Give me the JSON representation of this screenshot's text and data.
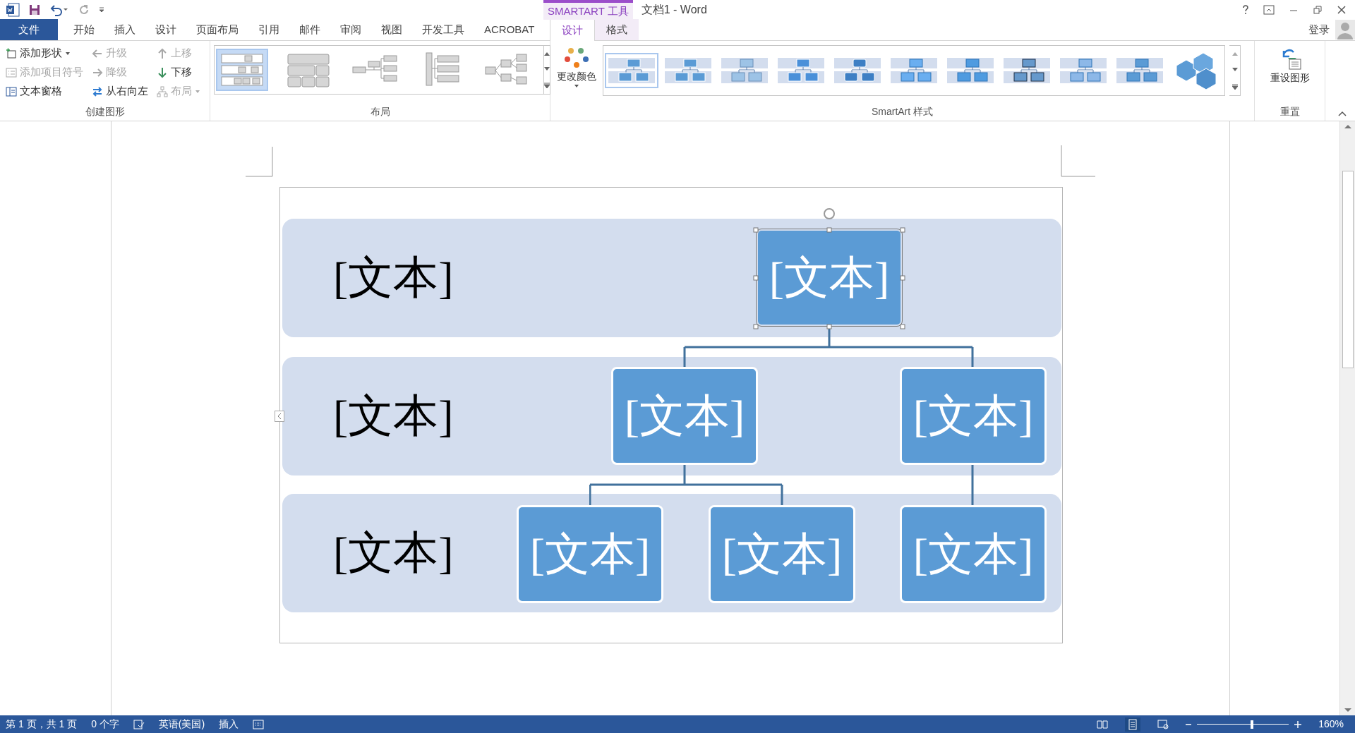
{
  "window": {
    "title": "文档1 - Word",
    "context_label": "SMARTART 工具",
    "sign_in": "登录"
  },
  "tabs": [
    {
      "label": "文件",
      "kind": "file",
      "selected": false
    },
    {
      "label": "开始",
      "kind": "tab",
      "selected": false
    },
    {
      "label": "插入",
      "kind": "tab",
      "selected": false
    },
    {
      "label": "设计",
      "kind": "tab",
      "selected": false
    },
    {
      "label": "页面布局",
      "kind": "tab",
      "selected": false
    },
    {
      "label": "引用",
      "kind": "tab",
      "selected": false
    },
    {
      "label": "邮件",
      "kind": "tab",
      "selected": false
    },
    {
      "label": "审阅",
      "kind": "tab",
      "selected": false
    },
    {
      "label": "视图",
      "kind": "tab",
      "selected": false
    },
    {
      "label": "开发工具",
      "kind": "tab",
      "selected": false
    },
    {
      "label": "ACROBAT",
      "kind": "tab",
      "selected": false
    },
    {
      "label": "设计",
      "kind": "context",
      "selected": true
    },
    {
      "label": "格式",
      "kind": "context",
      "selected": false
    }
  ],
  "create_group": {
    "label": "创建图形",
    "commands": [
      {
        "label": "添加形状",
        "disabled": false,
        "dropdown": true
      },
      {
        "label": "添加项目符号",
        "disabled": true,
        "dropdown": false
      },
      {
        "label": "文本窗格",
        "disabled": false,
        "dropdown": false
      },
      {
        "label": "升级",
        "disabled": true,
        "dropdown": false
      },
      {
        "label": "降级",
        "disabled": true,
        "dropdown": false
      },
      {
        "label": "从右向左",
        "disabled": false,
        "dropdown": false
      },
      {
        "label": "上移",
        "disabled": true,
        "dropdown": false
      },
      {
        "label": "下移",
        "disabled": false,
        "dropdown": false
      },
      {
        "label": "布局",
        "disabled": true,
        "dropdown": true
      }
    ]
  },
  "layout_group": {
    "label": "布局",
    "items": [
      {
        "selected": true
      },
      {
        "selected": false
      },
      {
        "selected": false
      },
      {
        "selected": false
      },
      {
        "selected": false
      }
    ]
  },
  "change_colors": {
    "label": "更改颜色"
  },
  "styles_group": {
    "label": "SmartArt 样式",
    "items": [
      {
        "selected": true
      },
      {
        "selected": false
      },
      {
        "selected": false
      },
      {
        "selected": false
      },
      {
        "selected": false
      },
      {
        "selected": false
      },
      {
        "selected": false
      },
      {
        "selected": false
      },
      {
        "selected": false
      },
      {
        "selected": false
      }
    ]
  },
  "reset_group": {
    "label": "重置",
    "button": "重设图形"
  },
  "diagram": {
    "rows": [
      {
        "label": "[文本]"
      },
      {
        "label": "[文本]"
      },
      {
        "label": "[文本]"
      }
    ],
    "nodes": [
      {
        "text": "[文本]",
        "selected": true
      },
      {
        "text": "[文本]",
        "selected": false
      },
      {
        "text": "[文本]",
        "selected": false
      },
      {
        "text": "[文本]",
        "selected": false
      },
      {
        "text": "[文本]",
        "selected": false
      },
      {
        "text": "[文本]",
        "selected": false
      }
    ]
  },
  "status_bar": {
    "page": "第 1 页，共 1 页",
    "words": "0 个字",
    "language": "英语(美国)",
    "mode": "插入",
    "zoom": "160%",
    "level": 0.6
  }
}
